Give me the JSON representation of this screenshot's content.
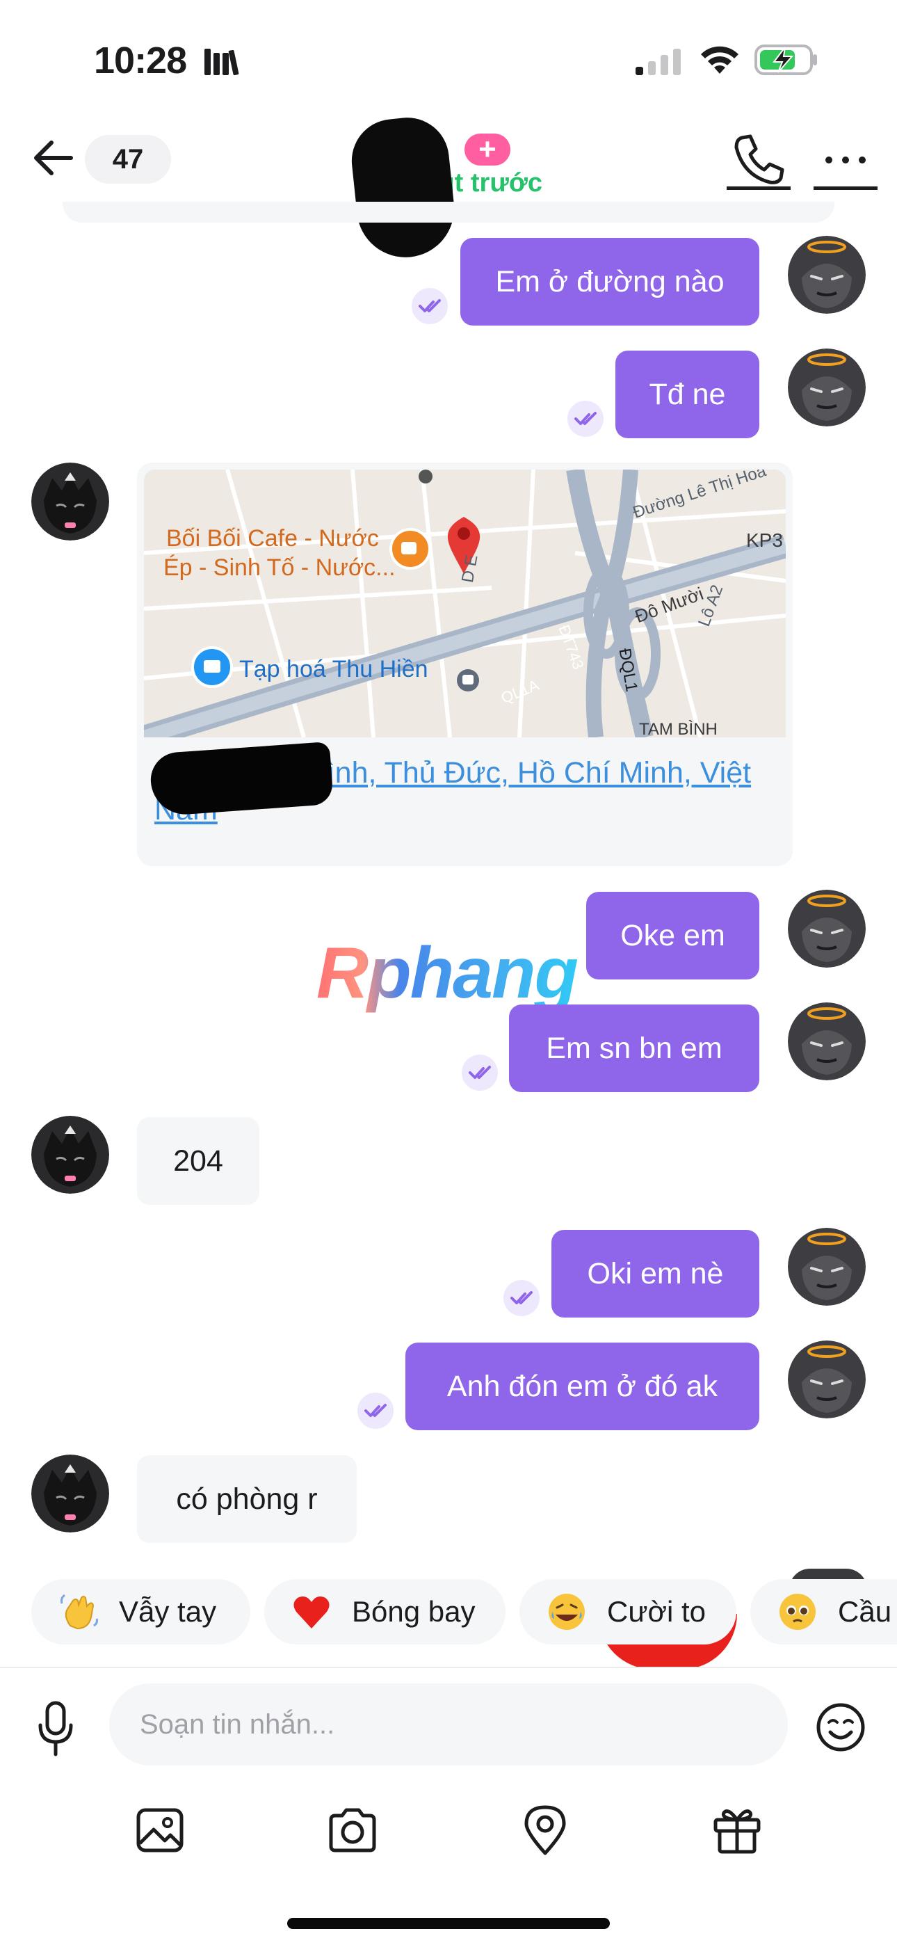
{
  "status_bar": {
    "time": "10:28"
  },
  "header": {
    "unread_count": "47",
    "add_symbol": "+",
    "subtitle": "ut trước"
  },
  "messages": [
    {
      "side": "out",
      "text": "Em ở đường nào"
    },
    {
      "side": "out",
      "text": "Tđ ne"
    },
    {
      "side": "in",
      "type": "location"
    },
    {
      "side": "out",
      "text": "Oke em"
    },
    {
      "side": "out",
      "text": "Em sn bn em"
    },
    {
      "side": "in",
      "text": "204"
    },
    {
      "side": "out",
      "text": "Oki em nè"
    },
    {
      "side": "out",
      "text": "Anh đón em ở đó ak"
    },
    {
      "side": "in",
      "text": "có phòng r"
    }
  ],
  "location": {
    "map_labels": {
      "cafe_line1": "Bối Bối Cafe - Nước",
      "cafe_line2": "Ép - Sinh Tố - Nước...",
      "grocery": "Tạp hoá Thu Hiền",
      "road_le_thi_hoa": "Đường Lê Thị Hoa",
      "kp3": "KP3",
      "do_muoi": "Đô Mười",
      "lo_a2": "Lô A2",
      "dt743": "ĐT743",
      "dql1": "ĐQL1",
      "ql1a": "QL1A",
      "tam_binh": "TAM BÌNH",
      "street_e": "D E"
    },
    "address": "...g D, Tam Bình, Thủ Đức, Hồ Chí Minh, Việt Nam"
  },
  "watermark": "Rphang",
  "quick_reactions": [
    {
      "label": "Vẫy tay",
      "icon": "waving-hand-emoji"
    },
    {
      "label": "Bóng bay",
      "icon": "heart-emoji"
    },
    {
      "label": "Cười to",
      "icon": "laughing-emoji"
    },
    {
      "label": "Cầu",
      "icon": "pleading-face-emoji"
    }
  ],
  "composer": {
    "placeholder": "Soạn tin nhắn..."
  },
  "colors": {
    "outgoing_bubble": "#8f65ea",
    "incoming_bubble": "#f5f6f8",
    "link": "#3b8fdc",
    "online_green": "#25c26b",
    "add_pink": "#ff5fa0"
  }
}
